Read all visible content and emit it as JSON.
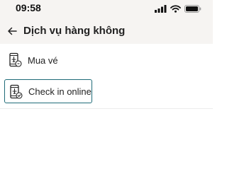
{
  "status_bar": {
    "time": "09:58"
  },
  "header": {
    "title": "Dịch vụ hàng không"
  },
  "menu": {
    "items": [
      {
        "label": "Mua vé",
        "icon": "ticket-phone-icon",
        "selected": false
      },
      {
        "label": "Check in online",
        "icon": "checkin-phone-icon",
        "selected": true
      }
    ]
  },
  "colors": {
    "accent": "#1f6b78",
    "header_bg": "#f6f4f2"
  }
}
